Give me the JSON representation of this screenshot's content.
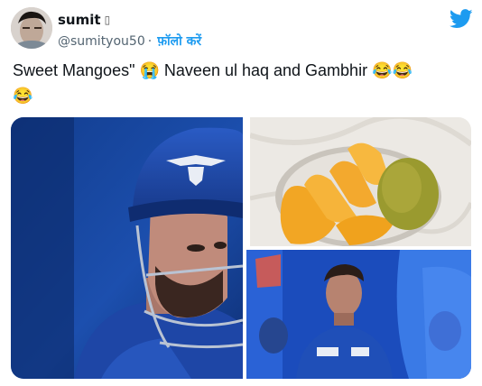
{
  "author": {
    "display_name": "sumit",
    "verified_glyph": "▯",
    "handle": "@sumityou50",
    "separator": "·",
    "follow_label": "फ़ॉलो करें"
  },
  "tweet": {
    "line1_a": "Sweet Mangoes\"",
    "emoji_crying": "😭",
    "line1_b": "Naveen ul haq and Gambhir",
    "emoji_laughing": "😂"
  },
  "icons": {
    "brand": "twitter-bird-icon"
  },
  "colors": {
    "accent": "#1d9bf0",
    "text": "#0f1419",
    "muted": "#536471",
    "jersey_blue": "#1f4fb8"
  }
}
